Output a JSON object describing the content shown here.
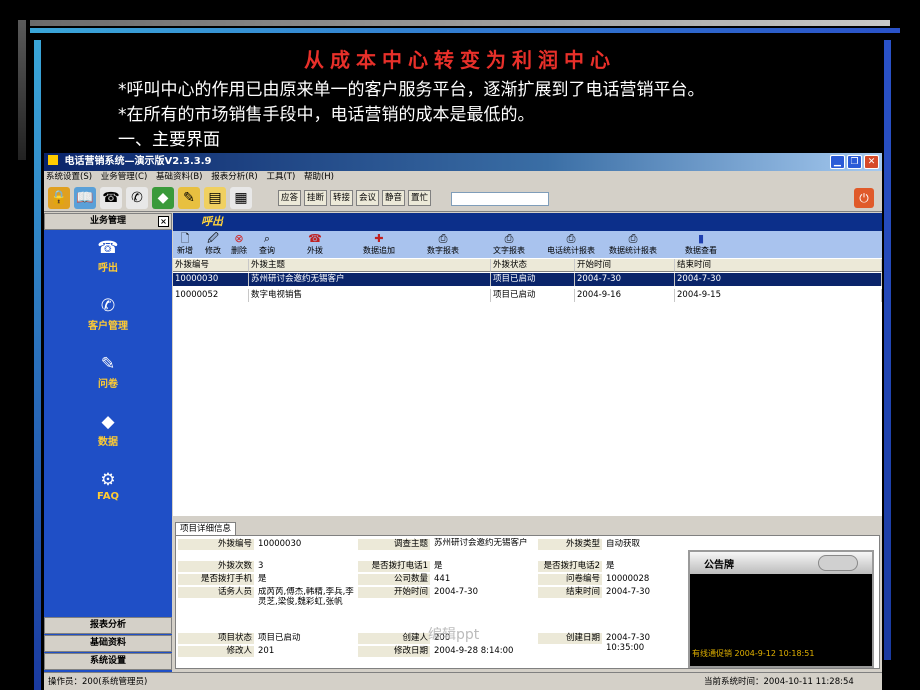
{
  "slide": {
    "title": "从成本中心转变为利润中心",
    "bullets": [
      "*呼叫中心的作用已由原来单一的客户服务平台，逐渐扩展到了电话营销平台。",
      "*在所有的市场销售手段中，电话营销的成本是最低的。",
      "一、主要界面"
    ],
    "watermark": "编辑ppt"
  },
  "window": {
    "title": "电话营销系统—演示版V2.3.3.9",
    "controls": [
      "minimize-icon",
      "restore-icon",
      "close-icon"
    ]
  },
  "menu": [
    "系统设置(S)",
    "业务管理(C)",
    "基础资料(B)",
    "报表分析(R)",
    "工具(T)",
    "帮助(H)"
  ],
  "toolbar": {
    "buttons": [
      "应答",
      "挂断",
      "转接",
      "会议",
      "静音",
      "置忙"
    ],
    "icons": [
      "lock-icon",
      "phone-book-icon",
      "handset-icon",
      "dial-icon",
      "diamond-icon",
      "edit-icon",
      "folder-icon",
      "notes-icon",
      "exit-icon"
    ]
  },
  "sidebar": {
    "header": "业务管理",
    "close": "×",
    "items": [
      {
        "label": "呼出",
        "icon": "handset-icon"
      },
      {
        "label": "客户管理",
        "icon": "phone-icon"
      },
      {
        "label": "问卷",
        "icon": "form-edit-icon"
      },
      {
        "label": "数据",
        "icon": "diamond-icon"
      },
      {
        "label": "FAQ",
        "icon": "gear-icon"
      }
    ],
    "bottom": [
      "报表分析",
      "基础资料",
      "系统设置"
    ]
  },
  "main": {
    "section_title": "呼出",
    "actions": [
      "新增",
      "修改",
      "删除",
      "查询",
      "外拨",
      "数据追加",
      "数字报表",
      "文字报表",
      "电话统计报表",
      "数据统计报表",
      "数据查看"
    ],
    "grid": {
      "columns": [
        "外拨编号",
        "外拨主题",
        "外拨状态",
        "开始时间",
        "结束时间"
      ],
      "rows": [
        [
          "10000030",
          "苏州研讨会邀约无锡客户",
          "项目已启动",
          "2004-7-30",
          "2004-7-30"
        ],
        [
          "10000052",
          "数字电视销售",
          "项目已启动",
          "2004-9-16",
          "2004-9-15"
        ]
      ]
    },
    "detail": {
      "tab": "项目详细信息",
      "fields": {
        "外拨编号": "10000030",
        "调查主题": "苏州研讨会邀约无锡客户",
        "外拨类型": "自动获取",
        "外拨次数": "3",
        "是否拨打电话1": "是",
        "是否拨打电话2": "是",
        "是否拨打手机": "是",
        "公司数量": "441",
        "问卷编号": "10000028",
        "话务人员": "成芮芮,傅杰,韩精,李兵,李灵芝,梁俊,魏彩虹,张帆",
        "开始时间": "2004-7-30",
        "结束时间": "2004-7-30",
        "项目状态": "项目已启动",
        "创建人": "200",
        "创建日期": "2004-7-30 10:35:00",
        "修改人": "201",
        "修改日期": "2004-9-28 8:14:00"
      }
    }
  },
  "notice": {
    "title": "公告牌",
    "message": "有线通促销  2004-9-12 10:18:51"
  },
  "status": {
    "operator": "操作员：200(系统管理员)",
    "time": "当前系统时间：2004-10-11 11:28:54"
  },
  "colors": {
    "slide_bg": "#000000",
    "title_red": "#e8302a",
    "sidebar_blue": "#1f4fc6",
    "sidebar_label": "#ffcc33",
    "selection": "#0a246a"
  }
}
